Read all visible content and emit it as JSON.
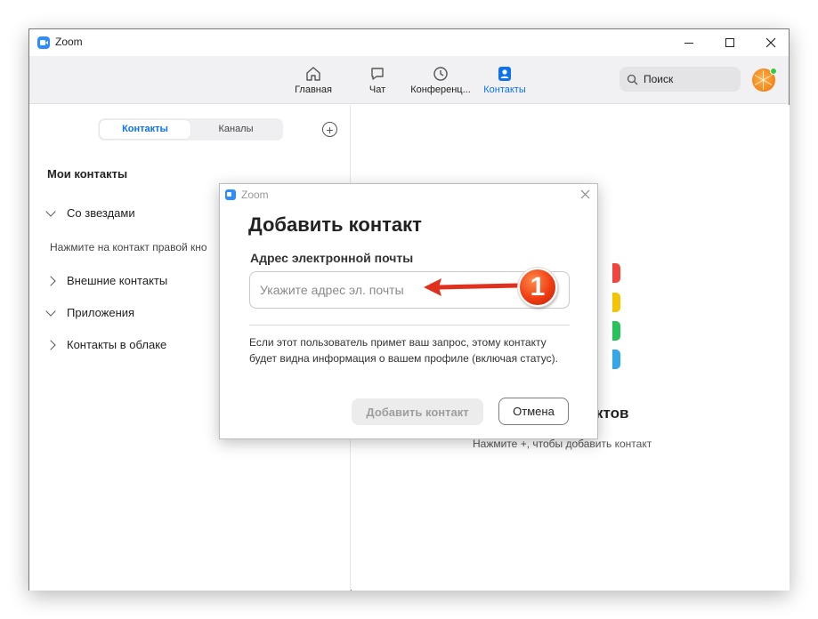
{
  "window": {
    "title": "Zoom"
  },
  "nav": {
    "tabs": [
      {
        "label": "Главная",
        "icon": "home-icon"
      },
      {
        "label": "Чат",
        "icon": "chat-icon"
      },
      {
        "label": "Конференц...",
        "icon": "clock-icon"
      },
      {
        "label": "Контакты",
        "icon": "contacts-icon",
        "active": true
      }
    ],
    "search_placeholder": "Поиск"
  },
  "left": {
    "segments": [
      "Контакты",
      "Каналы"
    ],
    "section_title": "Мои контакты",
    "tree": [
      {
        "label": "Со звездами",
        "expanded": true
      },
      {
        "label": "Внешние контакты",
        "expanded": false
      },
      {
        "label": "Приложения",
        "expanded": true
      },
      {
        "label": "Контакты в облаке",
        "expanded": false
      }
    ],
    "hint": "Нажмите на контакт правой кно"
  },
  "right": {
    "empty_title": "ктов",
    "empty_hint": "Нажмите +, чтобы добавить контакт",
    "bar_colors": [
      "#f0463d",
      "#f5c400",
      "#27c25a",
      "#33a7e8"
    ]
  },
  "dialog": {
    "app_name": "Zoom",
    "title": "Добавить контакт",
    "label": "Адрес электронной почты",
    "input_placeholder": "Укажите адрес эл. почты",
    "note": "Если этот пользователь примет ваш запрос, этому контакту будет видна информация о вашем профиле (включая статус).",
    "add_label": "Добавить контакт",
    "cancel_label": "Отмена"
  },
  "annotation": {
    "badge": "1",
    "color": "#e0301e"
  }
}
